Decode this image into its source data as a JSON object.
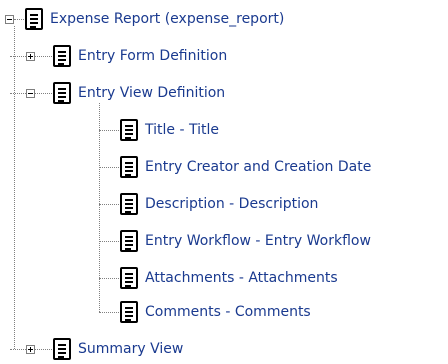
{
  "tree": {
    "root": {
      "label": "Expense Report (expense_report)",
      "toggle": "collapse",
      "icon": "document-icon"
    },
    "children": [
      {
        "label": "Entry Form Definition",
        "toggle": "expand",
        "icon": "document-icon"
      },
      {
        "label": "Entry View Definition",
        "toggle": "collapse",
        "icon": "document-icon",
        "children": [
          {
            "label": "Title - Title",
            "icon": "document-icon"
          },
          {
            "label": "Entry Creator and Creation Date",
            "icon": "document-icon"
          },
          {
            "label": "Description - Description",
            "icon": "document-icon"
          },
          {
            "label": "Entry Workflow - Entry Workflow",
            "icon": "document-icon"
          },
          {
            "label": "Attachments - Attachments",
            "icon": "document-icon"
          },
          {
            "label": "Comments - Comments",
            "icon": "document-icon"
          }
        ]
      },
      {
        "label": "Summary View",
        "toggle": "expand",
        "icon": "document-icon"
      }
    ]
  },
  "colors": {
    "link_text": "#1a3a8f",
    "connector": "#808080",
    "background": "#ffffff"
  }
}
